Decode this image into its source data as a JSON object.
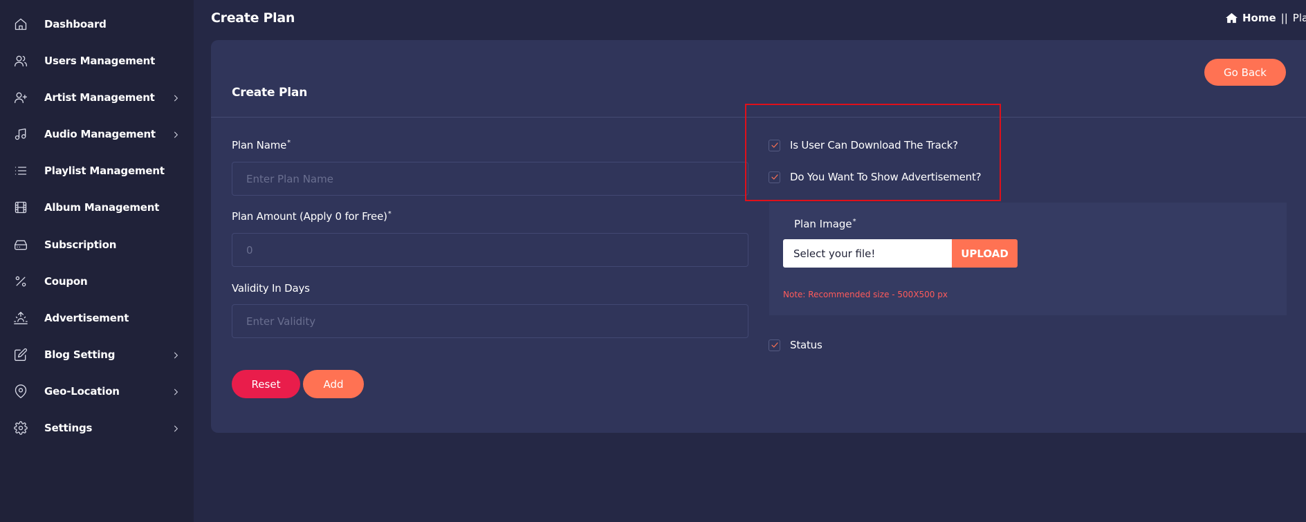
{
  "sidebar": {
    "items": [
      {
        "label": "Dashboard",
        "icon": "home-icon",
        "has_submenu": false
      },
      {
        "label": "Users Management",
        "icon": "users-icon",
        "has_submenu": false
      },
      {
        "label": "Artist Management",
        "icon": "user-plus-icon",
        "has_submenu": true
      },
      {
        "label": "Audio Management",
        "icon": "music-icon",
        "has_submenu": true
      },
      {
        "label": "Playlist Management",
        "icon": "list-icon",
        "has_submenu": false
      },
      {
        "label": "Album Management",
        "icon": "film-icon",
        "has_submenu": false
      },
      {
        "label": "Subscription",
        "icon": "hard-drive-icon",
        "has_submenu": false
      },
      {
        "label": "Coupon",
        "icon": "percent-icon",
        "has_submenu": false
      },
      {
        "label": "Advertisement",
        "icon": "sunrise-icon",
        "has_submenu": false
      },
      {
        "label": "Blog Setting",
        "icon": "edit-icon",
        "has_submenu": true
      },
      {
        "label": "Geo-Location",
        "icon": "map-pin-icon",
        "has_submenu": true
      },
      {
        "label": "Settings",
        "icon": "gear-icon",
        "has_submenu": true
      }
    ]
  },
  "header": {
    "title": "Create Plan",
    "breadcrumb": {
      "home": "Home",
      "separator": "||",
      "current": "Plan"
    }
  },
  "card": {
    "title": "Create Plan",
    "go_back_label": "Go Back"
  },
  "form": {
    "plan_name": {
      "label": "Plan Name",
      "required_mark": "*",
      "placeholder": "Enter Plan Name",
      "value": ""
    },
    "plan_amount": {
      "label": "Plan Amount (Apply 0 for Free)",
      "required_mark": "*",
      "placeholder": "0",
      "value": ""
    },
    "validity": {
      "label": "Validity In Days",
      "placeholder": "Enter Validity",
      "value": ""
    },
    "reset_label": "Reset",
    "add_label": "Add",
    "download_check": {
      "label": "Is User Can Download The Track?",
      "checked": true
    },
    "advertisement_check": {
      "label": "Do You Want To Show Advertisement?",
      "checked": true
    },
    "plan_image": {
      "label": "Plan Image",
      "required_mark": "*",
      "file_text": "Select your file!",
      "upload_label": "UPLOAD",
      "note": "Note: Recommended size - 500X500 px"
    },
    "status_check": {
      "label": "Status",
      "checked": true
    }
  },
  "colors": {
    "background": "#252845",
    "sidebar": "#202239",
    "card": "#30355a",
    "accent": "#ff7253",
    "reset": "#e91d4b",
    "highlight": "#e0101a",
    "note": "#ff5b5b"
  }
}
